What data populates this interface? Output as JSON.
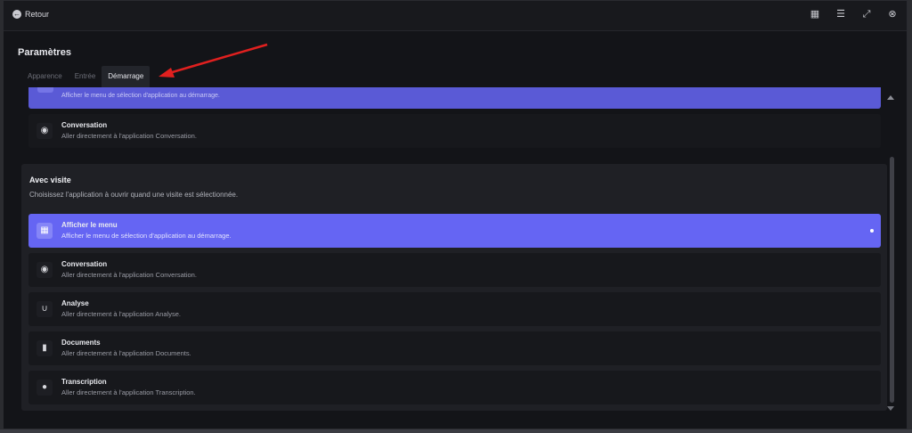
{
  "topbar": {
    "back_label": "Retour",
    "icons": [
      "grid-icon",
      "menu-icon",
      "shrink-icon",
      "close-circle-icon"
    ]
  },
  "page_title": "Paramètres",
  "tabs": [
    {
      "label": "Apparence",
      "active": false
    },
    {
      "label": "Entrée",
      "active": false
    },
    {
      "label": "Démarrage",
      "active": true
    }
  ],
  "upper_section": {
    "partial_selected_desc": "Afficher le menu de sélection d'application au démarrage.",
    "options": [
      {
        "name": "Conversation",
        "desc": "Aller directement à l'application Conversation.",
        "icon": "chat-icon"
      }
    ]
  },
  "visit_section": {
    "title": "Avec visite",
    "subtitle": "Choisissez l'application à ouvrir quand une visite est sélectionnée.",
    "options": [
      {
        "name": "Afficher le menu",
        "desc": "Afficher le menu de sélection d'application au démarrage.",
        "icon": "grid-icon",
        "selected": true
      },
      {
        "name": "Conversation",
        "desc": "Aller directement à l'application Conversation.",
        "icon": "chat-icon",
        "selected": false
      },
      {
        "name": "Analyse",
        "desc": "Aller directement à l'application Analyse.",
        "icon": "stethoscope-icon",
        "selected": false
      },
      {
        "name": "Documents",
        "desc": "Aller directement à l'application Documents.",
        "icon": "document-icon",
        "selected": false
      },
      {
        "name": "Transcription",
        "desc": "Aller directement à l'application Transcription.",
        "icon": "microphone-icon",
        "selected": false
      }
    ]
  },
  "colors": {
    "accent": "#6565f3",
    "background": "#131418",
    "annotation_arrow": "#e0201f"
  }
}
